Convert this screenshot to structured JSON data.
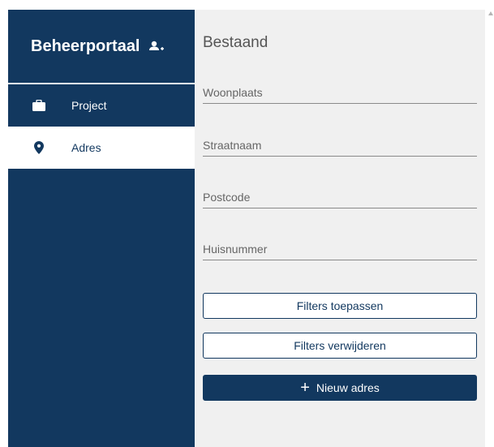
{
  "sidebar": {
    "title": "Beheerportaal",
    "title_icon": "user-add-icon",
    "items": [
      {
        "label": "Project",
        "icon": "briefcase-icon",
        "active": false
      },
      {
        "label": "Adres",
        "icon": "map-pin-icon",
        "active": true
      }
    ]
  },
  "main": {
    "heading": "Bestaand",
    "fields": {
      "woonplaats": {
        "placeholder": "Woonplaats",
        "value": ""
      },
      "straatnaam": {
        "placeholder": "Straatnaam",
        "value": ""
      },
      "postcode": {
        "placeholder": "Postcode",
        "value": ""
      },
      "huisnummer": {
        "placeholder": "Huisnummer",
        "value": ""
      }
    },
    "buttons": {
      "apply": "Filters toepassen",
      "remove": "Filters verwijderen",
      "new_plus": "+",
      "new": "Nieuw adres"
    }
  },
  "colors": {
    "primary": "#12385f",
    "panel": "#f0f0f0",
    "white": "#ffffff"
  }
}
